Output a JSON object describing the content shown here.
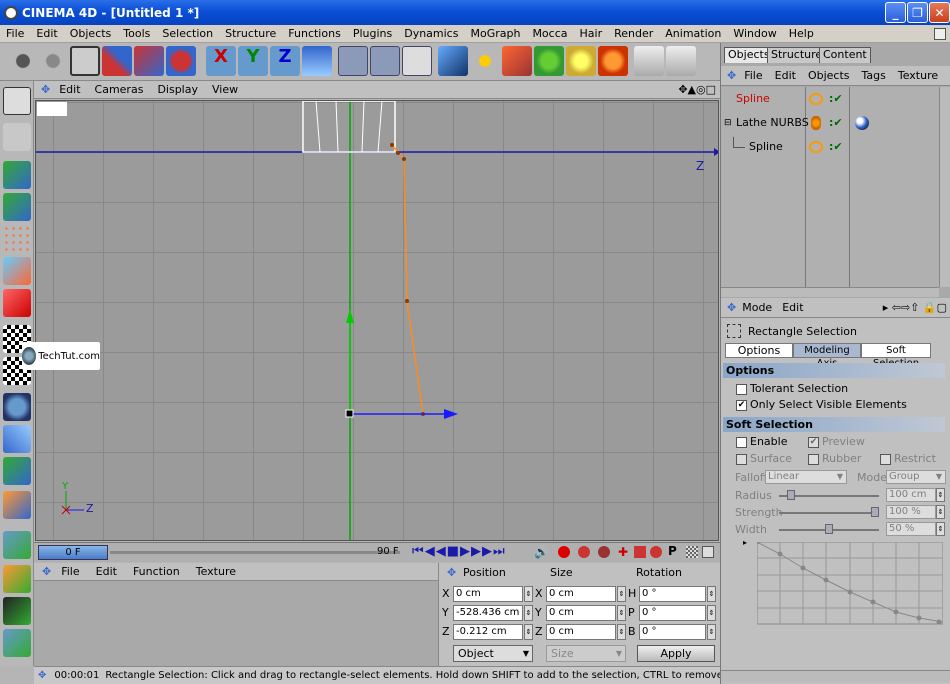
{
  "window": {
    "title": "CINEMA 4D - [Untitled 1 *]",
    "minimize_icon": "minimize-icon",
    "maximize_icon": "maximize-icon",
    "close_icon": "close-icon"
  },
  "menubar": {
    "items": [
      "File",
      "Edit",
      "Objects",
      "Tools",
      "Selection",
      "Structure",
      "Functions",
      "Plugins",
      "Dynamics",
      "MoGraph",
      "Mocca",
      "Hair",
      "Render",
      "Animation",
      "Window",
      "Help"
    ]
  },
  "viewport": {
    "menu": [
      "Edit",
      "Cameras",
      "Display",
      "View"
    ],
    "axis_z_label": "Z",
    "axis_y_label": "Y",
    "axis_z_small": "Z",
    "watermark": "TechTut.com",
    "colors": {
      "grid": "#888888",
      "bg": "#9b9b9b",
      "horizon": "#1a1aaa",
      "y_axis": "#00aa00",
      "spline": "#ff8c1a"
    }
  },
  "timeline": {
    "current_frame": "0 F",
    "end_frame": "90 F"
  },
  "material_manager": {
    "menu": [
      "File",
      "Edit",
      "Function",
      "Texture"
    ]
  },
  "coordinates": {
    "headers": {
      "position": "Position",
      "size": "Size",
      "rotation": "Rotation"
    },
    "rows": [
      {
        "pos_axis": "X",
        "pos_value": "0 cm",
        "size_axis": "X",
        "size_value": "0 cm",
        "rot_axis": "H",
        "rot_value": "0 °"
      },
      {
        "pos_axis": "Y",
        "pos_value": "-528.436 cm",
        "size_axis": "Y",
        "size_value": "0 cm",
        "rot_axis": "P",
        "rot_value": "0 °"
      },
      {
        "pos_axis": "Z",
        "pos_value": "-0.212 cm",
        "size_axis": "Z",
        "size_value": "0 cm",
        "rot_axis": "B",
        "rot_value": "0 °"
      }
    ],
    "mode_select": "Object",
    "size_select": "Size",
    "apply_label": "Apply"
  },
  "status": {
    "time": "00:00:01",
    "message": "Rectangle Selection: Click and drag to rectangle-select elements. Hold down SHIFT to add to the selection, CTRL to remove."
  },
  "object_manager": {
    "tabs": [
      "Objects",
      "Structure",
      "Content"
    ],
    "menu": [
      "File",
      "Edit",
      "Objects",
      "Tags",
      "Texture"
    ],
    "objects": [
      {
        "name": "Spline",
        "color": "#cc0000"
      },
      {
        "name": "Lathe NURBS",
        "color": "#000000"
      },
      {
        "name": "Spline",
        "color": "#000000"
      }
    ]
  },
  "attributes": {
    "menu": [
      "Mode",
      "Edit"
    ],
    "tool_name": "Rectangle Selection",
    "tabs": [
      "Options",
      "Modeling Axis",
      "Soft Selection"
    ],
    "options_header": "Options",
    "tolerant_selection": "Tolerant Selection",
    "tolerant_checked": false,
    "only_visible": "Only Select Visible Elements",
    "only_visible_checked": true,
    "soft_header": "Soft Selection",
    "enable": "Enable",
    "preview": "Preview",
    "surface": "Surface",
    "rubber": "Rubber",
    "restrict": "Restrict",
    "falloff_label": "Falloff",
    "falloff_value": "Linear",
    "mode_label": "Mode",
    "mode_value": "Group",
    "radius_label": "Radius",
    "radius_value": "100 cm",
    "strength_label": "Strength",
    "strength_value": "100 %",
    "width_label": "Width",
    "width_value": "50 %"
  }
}
